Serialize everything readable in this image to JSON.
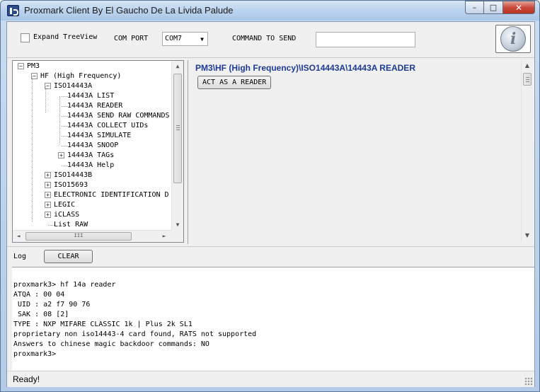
{
  "window": {
    "title": "Proxmark Client By El Gaucho De La Livida Palude",
    "minimize": "–",
    "maximize": "□",
    "close": "✕"
  },
  "toolbar": {
    "expand_treeview_label": "Expand TreeView",
    "com_port_label": "COM PORT",
    "com_port_value": "COM7",
    "command_label": "COMMAND TO SEND",
    "command_value": "",
    "info_icon": "i"
  },
  "tree": {
    "nodes": [
      {
        "label": "PM3",
        "expander": "−"
      },
      {
        "label": "HF (High Frequency)",
        "expander": "−"
      },
      {
        "label": "ISO14443A",
        "expander": "−"
      },
      {
        "label": "14443A LIST"
      },
      {
        "label": "14443A READER"
      },
      {
        "label": "14443A SEND RAW COMMANDS"
      },
      {
        "label": "14443A COLLECT UIDs"
      },
      {
        "label": "14443A SIMULATE"
      },
      {
        "label": "14443A SNOOP"
      },
      {
        "label": "14443A TAGs",
        "expander": "+"
      },
      {
        "label": "14443A Help"
      },
      {
        "label": "ISO14443B",
        "expander": "+"
      },
      {
        "label": "ISO15693",
        "expander": "+"
      },
      {
        "label": "ELECTRONIC IDENTIFICATION D",
        "expander": "+"
      },
      {
        "label": "LEGIC",
        "expander": "+"
      },
      {
        "label": "iCLASS",
        "expander": "+"
      },
      {
        "label": "List RAW"
      }
    ],
    "scroll_up": "▲",
    "scroll_down": "▼",
    "scroll_left": "◄",
    "scroll_right": "►",
    "hthumb_grip": "III"
  },
  "panel": {
    "path": "PM3\\HF (High Frequency)\\ISO14443A\\14443A READER",
    "act_button": "ACT AS A READER"
  },
  "log": {
    "label": "Log",
    "clear_button": "CLEAR",
    "lines": [
      "proxmark3> hf 14a reader",
      "ATQA : 00 04",
      " UID : a2 f7 90 76",
      " SAK : 08 [2]",
      "TYPE : NXP MIFARE CLASSIC 1k | Plus 2k SL1",
      "proprietary non iso14443-4 card found, RATS not supported",
      "Answers to chinese magic backdoor commands: NO",
      "proxmark3>"
    ]
  },
  "status": {
    "text": "Ready!"
  }
}
